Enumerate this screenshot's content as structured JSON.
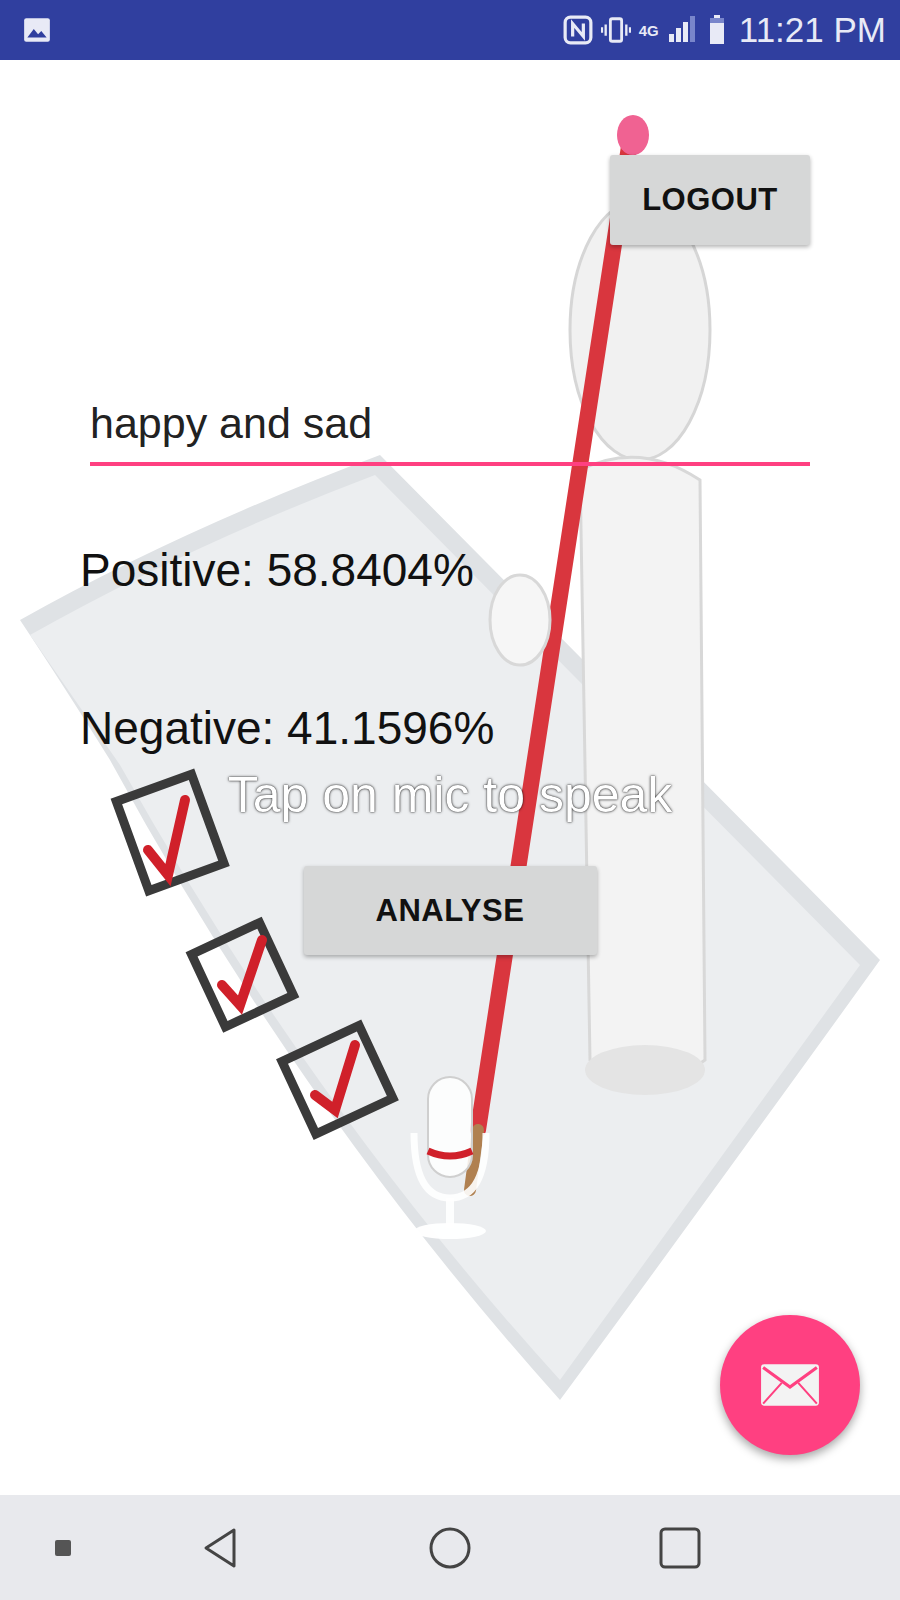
{
  "status_bar": {
    "time": "11:21 PM",
    "network": "4G",
    "signal_level": 0.75,
    "battery_level": 0.85
  },
  "logout_button": "LOGOUT",
  "input": {
    "value": "happy and sad",
    "focused": true
  },
  "results": [
    "Positive: 58.8404%",
    "Negative: 41.1596%"
  ],
  "hint": "Tap on mic to speak",
  "analyse_button": "ANALYSE"
}
